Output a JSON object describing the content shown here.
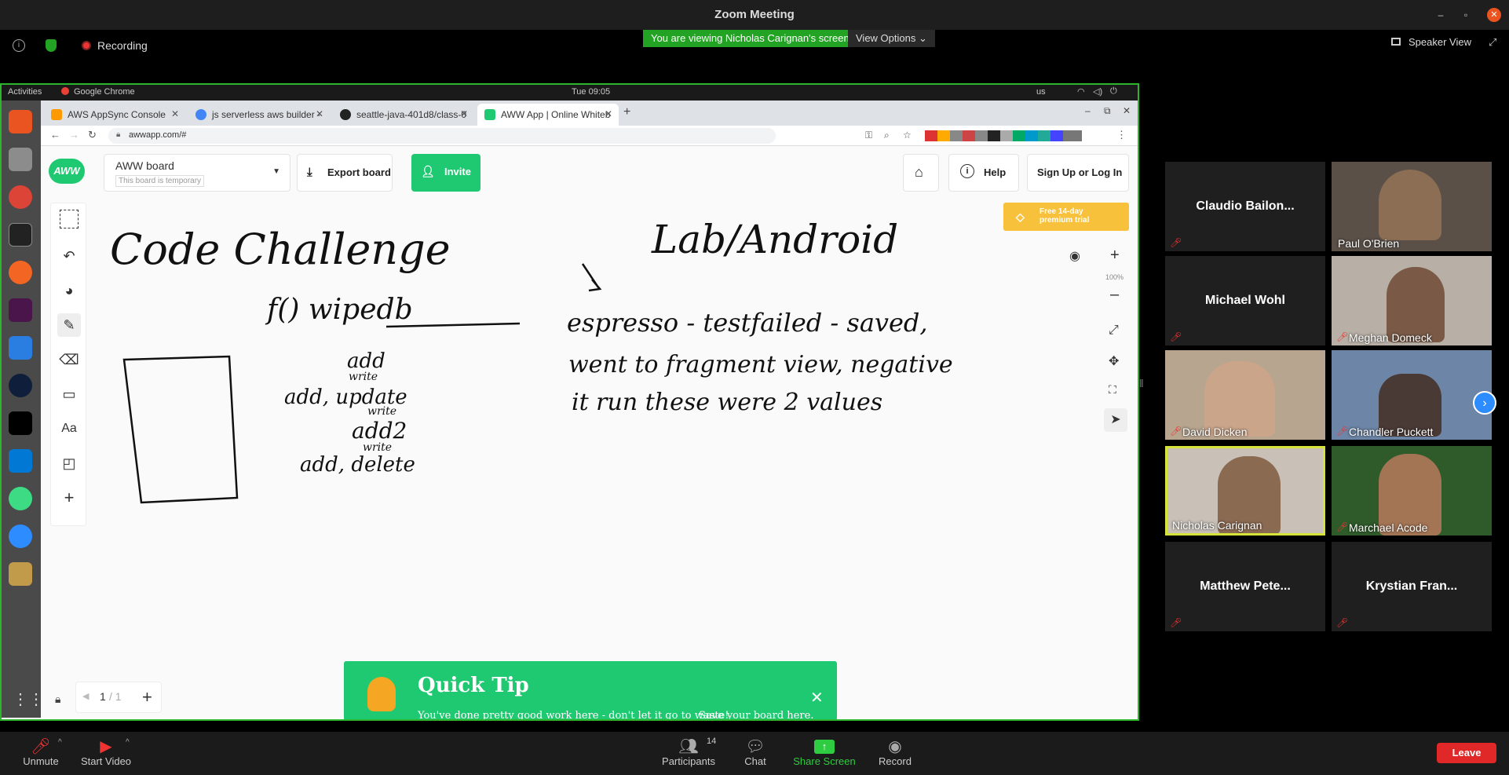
{
  "window": {
    "title": "Zoom Meeting"
  },
  "zoom_top": {
    "recording_label": "Recording",
    "viewing_banner": "You are viewing Nicholas Carignan's screen",
    "view_options": "View Options",
    "speaker_view": "Speaker View"
  },
  "ubuntu": {
    "activities": "Activities",
    "app": "Google Chrome",
    "clock": "Tue 09:05",
    "lang": "us"
  },
  "chrome": {
    "tabs": [
      {
        "label": "AWS AppSync Console",
        "color": "#ff9900"
      },
      {
        "label": "js serverless aws builder -",
        "color": "#4285f4"
      },
      {
        "label": "seattle-java-401d8/class-0",
        "color": "#222222"
      },
      {
        "label": "AWW App | Online Whiteb",
        "color": "#1ec971"
      }
    ],
    "url": "awwapp.com/#"
  },
  "aww": {
    "logo": "AWW",
    "board_name": "AWW board",
    "board_note": "This board is temporary",
    "export": "Export board",
    "invite": "Invite",
    "help": "Help",
    "signup": "Sign Up or Log In",
    "premium": "Free 14-day premium trial",
    "zoom_level": "100%",
    "page_current": "1",
    "page_total": "/ 1",
    "tools_text": "Aa"
  },
  "handwriting": {
    "code_challenge": "Code Challenge",
    "wipedb": "f() wipedb",
    "lab_android": "Lab/Android",
    "espresso": "espresso - testfailed - saved,",
    "went": "went to fragment view, negative",
    "run": "it run these were 2 values",
    "notes": [
      "add",
      "write",
      "add, update",
      "write",
      "add2",
      "write",
      "add, delete"
    ]
  },
  "tip": {
    "title": "Quick Tip",
    "body": "You've done pretty good work here - don't let it go to waste!",
    "link": "Save your board here."
  },
  "participants": [
    {
      "name": "Claudio Bailon...",
      "video": false
    },
    {
      "name": "Paul O'Brien",
      "video": true
    },
    {
      "name": "Michael Wohl",
      "video": false
    },
    {
      "name": "Meghan Domeck",
      "video": true
    },
    {
      "name": "David Dicken",
      "video": true
    },
    {
      "name": "Chandler Puckett",
      "video": true
    },
    {
      "name": "Nicholas Carignan",
      "video": true
    },
    {
      "name": "Marchael Acode",
      "video": true
    },
    {
      "name": "Matthew Pete...",
      "video": false
    },
    {
      "name": "Krystian Fran...",
      "video": false
    }
  ],
  "bottom": {
    "unmute": "Unmute",
    "start_video": "Start Video",
    "participants_label": "Participants",
    "participants_count": "14",
    "chat": "Chat",
    "share": "Share Screen",
    "record": "Record",
    "leave": "Leave"
  }
}
